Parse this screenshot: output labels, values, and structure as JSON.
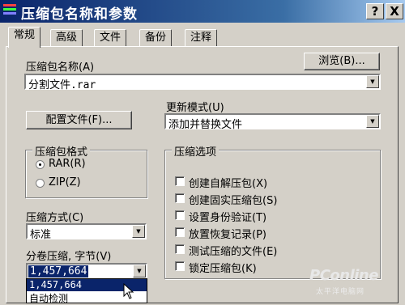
{
  "window": {
    "title": "压缩包名称和参数",
    "help_button": "?",
    "close_button": "X"
  },
  "tabs": [
    {
      "label": "常规",
      "active": true
    },
    {
      "label": "高级",
      "active": false
    },
    {
      "label": "文件",
      "active": false
    },
    {
      "label": "备份",
      "active": false
    },
    {
      "label": "注释",
      "active": false
    }
  ],
  "archive_name": {
    "label": "压缩包名称(A)",
    "value": "分割文件.rar",
    "browse_button": "浏览(B)..."
  },
  "update_mode": {
    "label": "更新模式(U)",
    "value": "添加并替换文件"
  },
  "profiles_button": "配置文件(F)...",
  "archive_format": {
    "title": "压缩包格式",
    "options": [
      {
        "label": "RAR(R)",
        "checked": true
      },
      {
        "label": "ZIP(Z)",
        "checked": false
      }
    ]
  },
  "compression_method": {
    "label": "压缩方式(C)",
    "value": "标准"
  },
  "volume_size": {
    "label": "分卷压缩, 字节(V)",
    "value": "1,457,664",
    "options": [
      "1,457,664",
      "自动检测"
    ]
  },
  "archive_options": {
    "title": "压缩选项",
    "items": [
      {
        "label": "创建自解压包(X)",
        "checked": false
      },
      {
        "label": "创建固实压缩包(S)",
        "checked": false
      },
      {
        "label": "设置身份验证(T)",
        "checked": false
      },
      {
        "label": "放置恢复记录(P)",
        "checked": false
      },
      {
        "label": "测试压缩的文件(E)",
        "checked": false
      },
      {
        "label": "锁定压缩包(K)",
        "checked": false
      }
    ]
  },
  "watermark": {
    "brand": "PConline",
    "sub": "太平洋电脑网"
  }
}
